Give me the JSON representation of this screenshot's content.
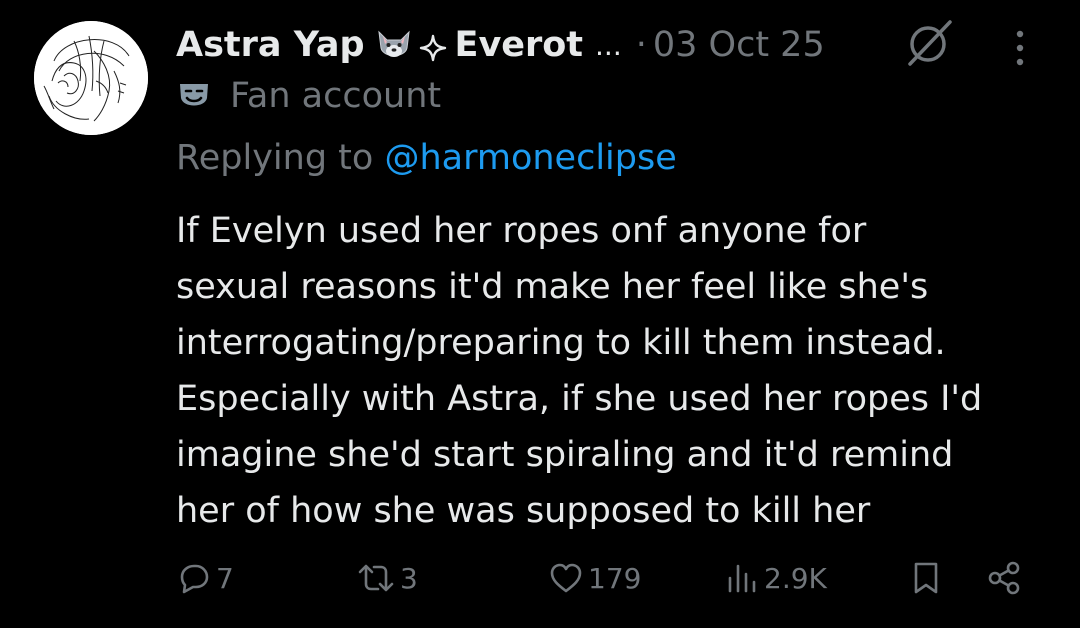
{
  "author": {
    "name": "Astra Yap",
    "name_emoji_icon": "wolf-face-icon",
    "handle_prefix_icon": "sparkle-star-icon",
    "handle": "Everot",
    "handle_truncation": "...",
    "separator": "·",
    "date": "03 Oct 25",
    "label": "Fan account",
    "label_icon": "theater-mask-icon"
  },
  "reply": {
    "prefix": "Replying to ",
    "mention": "@harmoneclipse"
  },
  "post": {
    "text": "If Evelyn used her ropes onf anyone for\nsexual reasons it'd make her feel like she's\ninterrogating/preparing to kill them instead.\nEspecially with Astra, if she used her ropes I'd\nimagine she'd start spiraling and it'd remind\nher of how she was supposed to kill her"
  },
  "actions": {
    "replies": "7",
    "reposts": "3",
    "likes": "179",
    "views": "2.9K"
  },
  "colors": {
    "background": "#000000",
    "text": "#e7e9ea",
    "muted": "#71767b",
    "link": "#1d9bf0"
  }
}
